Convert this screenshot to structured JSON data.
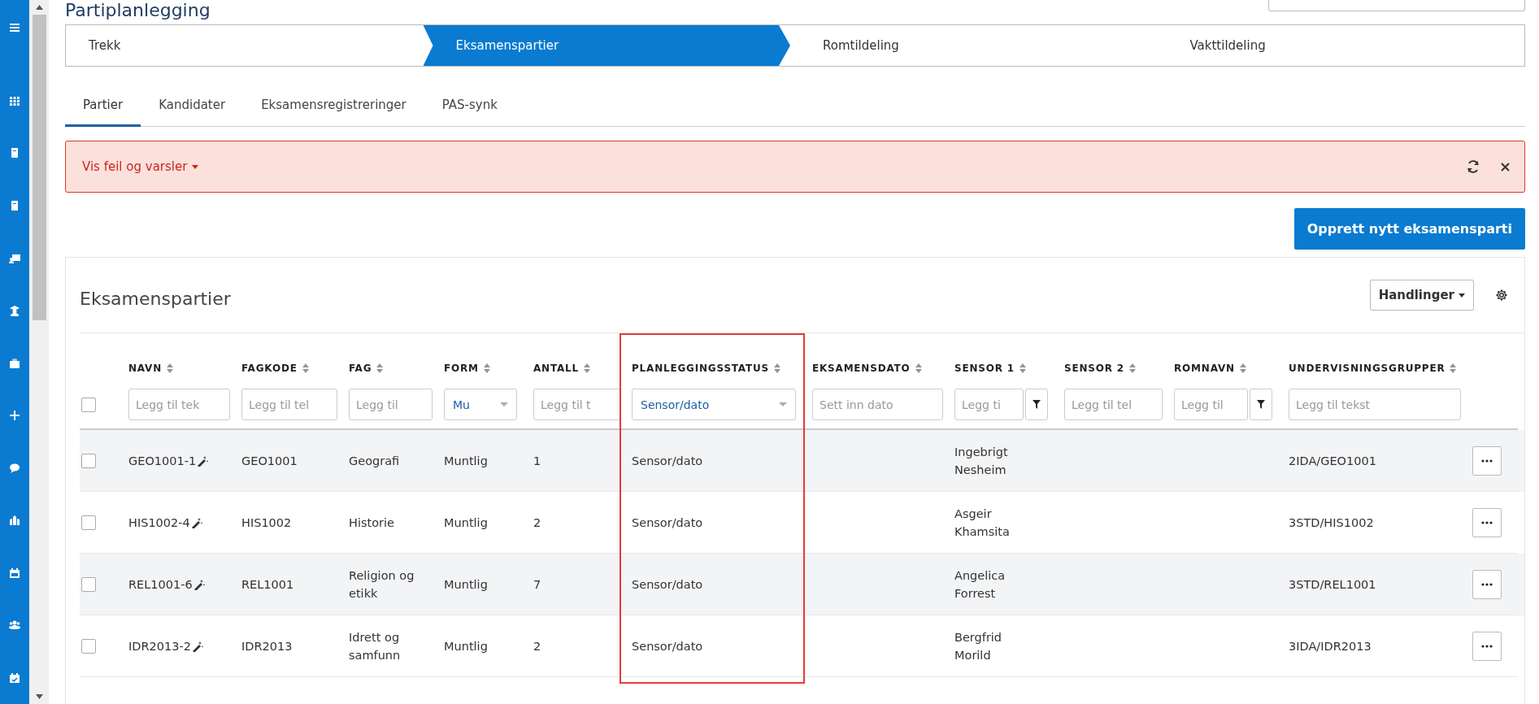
{
  "page_title": "Partiplanlegging",
  "steps": [
    {
      "label": "Trekk",
      "selected": false
    },
    {
      "label": "Eksamenspartier",
      "selected": true
    },
    {
      "label": "Romtildeling",
      "selected": false
    },
    {
      "label": "Vakttildeling",
      "selected": false
    }
  ],
  "tabs": [
    {
      "label": "Partier",
      "selected": true
    },
    {
      "label": "Kandidater",
      "selected": false
    },
    {
      "label": "Eksamensregistreringer",
      "selected": false
    },
    {
      "label": "PAS-synk",
      "selected": false
    }
  ],
  "alert": {
    "label": "Vis feil og varsler"
  },
  "create_button": "Opprett nytt eksamensparti",
  "card": {
    "title": "Eksamenspartier",
    "actions_button": "Handlinger"
  },
  "table": {
    "select_all": {
      "checked": false
    },
    "columns": [
      {
        "label": "NAVN",
        "filter": {
          "kind": "text",
          "placeholder": "Legg til tek"
        }
      },
      {
        "label": "FAGKODE",
        "filter": {
          "kind": "text",
          "placeholder": "Legg til tel"
        }
      },
      {
        "label": "FAG",
        "filter": {
          "kind": "text",
          "placeholder": "Legg til"
        }
      },
      {
        "label": "FORM",
        "filter": {
          "kind": "select",
          "value": "Mu"
        }
      },
      {
        "label": "ANTALL",
        "filter": {
          "kind": "text",
          "placeholder": "Legg til t"
        }
      },
      {
        "label": "PLANLEGGINGSSTATUS",
        "filter": {
          "kind": "select",
          "value": "Sensor/dato"
        },
        "highlighted": true
      },
      {
        "label": "EKSAMENSDATO",
        "filter": {
          "kind": "text",
          "placeholder": "Sett inn dato"
        }
      },
      {
        "label": "SENSOR 1",
        "filter": {
          "kind": "text_filter",
          "placeholder": "Legg ti"
        }
      },
      {
        "label": "SENSOR 2",
        "filter": {
          "kind": "text",
          "placeholder": "Legg til tel"
        }
      },
      {
        "label": "ROMNAVN",
        "filter": {
          "kind": "text_filter",
          "placeholder": "Legg til"
        }
      },
      {
        "label": "UNDERVISNINGSGRUPPER",
        "filter": {
          "kind": "text",
          "placeholder": "Legg til tekst"
        }
      }
    ],
    "rows": [
      {
        "checked": false,
        "cells": [
          "GEO1001-1",
          "GEO1001",
          "Geografi",
          "Muntlig",
          "1",
          "Sensor/dato",
          "",
          "Ingebrigt Nesheim",
          "",
          "",
          "2IDA/GEO1001"
        ]
      },
      {
        "checked": false,
        "cells": [
          "HIS1002-4",
          "HIS1002",
          "Historie",
          "Muntlig",
          "2",
          "Sensor/dato",
          "",
          "Asgeir Khamsita",
          "",
          "",
          "3STD/HIS1002"
        ]
      },
      {
        "checked": false,
        "cells": [
          "REL1001-6",
          "REL1001",
          "Religion og etikk",
          "Muntlig",
          "7",
          "Sensor/dato",
          "",
          "Angelica Forrest",
          "",
          "",
          "3STD/REL1001"
        ]
      },
      {
        "checked": false,
        "cells": [
          "IDR2013-2",
          "IDR2013",
          "Idrett og samfunn",
          "Muntlig",
          "2",
          "Sensor/dato",
          "",
          "Bergfrid Morild",
          "",
          "",
          "3IDA/IDR2013"
        ]
      }
    ]
  }
}
